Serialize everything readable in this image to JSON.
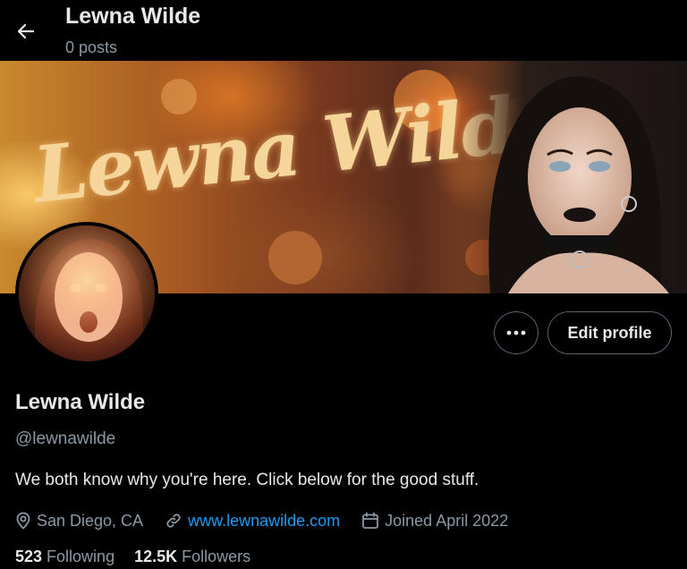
{
  "header": {
    "title": "Lewna Wilde",
    "post_count": "0 posts"
  },
  "banner": {
    "script_text": "Lewna Wilde"
  },
  "actions": {
    "more_icon": "more-horizontal-icon",
    "edit_profile_label": "Edit profile"
  },
  "profile": {
    "display_name": "Lewna Wilde",
    "handle": "@lewnawilde",
    "bio": "We both know why you're here. Click below for the good stuff.",
    "location": "San Diego, CA",
    "website": "www.lewnawilde.com",
    "joined": "Joined April 2022"
  },
  "stats": {
    "following_count": "523",
    "following_label": "Following",
    "followers_count": "12.5K",
    "followers_label": "Followers"
  },
  "colors": {
    "background": "#000000",
    "text_primary": "#e7e9ea",
    "text_secondary": "#8b98a5",
    "link": "#1d9bf0",
    "border": "#536471"
  }
}
